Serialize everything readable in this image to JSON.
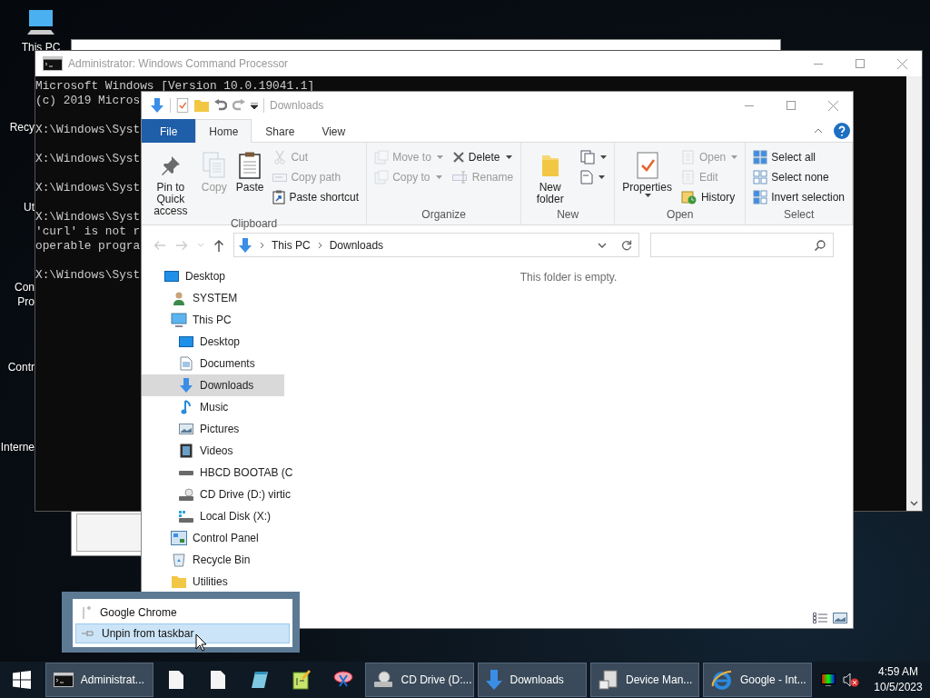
{
  "desktop_icons": [
    {
      "lines": [
        "This PC"
      ]
    },
    {
      "lines": [
        "Recy"
      ]
    },
    {
      "lines": [
        "Ut"
      ]
    },
    {
      "lines": [
        "Con",
        "Pro"
      ]
    },
    {
      "lines": [
        "Contr"
      ]
    },
    {
      "lines": [
        "Interne"
      ]
    }
  ],
  "cmd_window": {
    "title": "Administrator: Windows Command Processor",
    "blocks": [
      [
        "Microsoft Windows [Version 10.0.19041.1]",
        "(c) 2019 Micros"
      ],
      [
        "X:\\Windows\\Syst"
      ],
      [
        "X:\\Windows\\Syst"
      ],
      [
        "X:\\Windows\\Syst"
      ],
      [
        "X:\\Windows\\Syst",
        "'curl' is not r",
        "operable progra"
      ],
      [
        "X:\\Windows\\Syst"
      ]
    ]
  },
  "explorer": {
    "title": "Downloads",
    "tabs": [
      {
        "label": "File",
        "kind": "file",
        "selected": false
      },
      {
        "label": "Home",
        "kind": "tab",
        "selected": true
      },
      {
        "label": "Share",
        "kind": "tab",
        "selected": false
      },
      {
        "label": "View",
        "kind": "tab",
        "selected": false
      }
    ],
    "ribbon": {
      "groups": [
        {
          "label": "Clipboard",
          "columns": [
            {
              "kind": "large",
              "items": [
                {
                  "label": "Pin to Quick access",
                  "disabled": false,
                  "dropdown": false
                }
              ]
            },
            {
              "kind": "large",
              "items": [
                {
                  "label": "Copy",
                  "disabled": true,
                  "dropdown": false
                }
              ]
            },
            {
              "kind": "large",
              "items": [
                {
                  "label": "Paste",
                  "disabled": false,
                  "dropdown": false
                }
              ]
            },
            {
              "kind": "stack",
              "items": [
                {
                  "label": "Cut",
                  "disabled": true,
                  "dropdown": false
                },
                {
                  "label": "Copy path",
                  "disabled": true,
                  "dropdown": false
                },
                {
                  "label": "Paste shortcut",
                  "disabled": false,
                  "dropdown": false
                }
              ]
            }
          ]
        },
        {
          "label": "Organize",
          "columns": [
            {
              "kind": "stack",
              "items": [
                {
                  "label": "Move to",
                  "disabled": true,
                  "dropdown": true
                },
                {
                  "label": "Copy to",
                  "disabled": true,
                  "dropdown": true
                }
              ]
            },
            {
              "kind": "stack",
              "items": [
                {
                  "label": "Delete",
                  "disabled": false,
                  "dropdown": true
                },
                {
                  "label": "Rename",
                  "disabled": true,
                  "dropdown": false
                }
              ]
            }
          ]
        },
        {
          "label": "New",
          "columns": [
            {
              "kind": "large",
              "items": [
                {
                  "label": "New folder",
                  "disabled": false,
                  "dropdown": false
                }
              ]
            },
            {
              "kind": "stack",
              "items": [
                {
                  "disabled": false,
                  "dropdown": true
                },
                {
                  "disabled": false,
                  "dropdown": true
                }
              ]
            }
          ]
        },
        {
          "label": "Open",
          "columns": [
            {
              "kind": "large",
              "items": [
                {
                  "label": "Properties",
                  "disabled": false,
                  "dropdown": true
                }
              ]
            },
            {
              "kind": "stack",
              "items": [
                {
                  "label": "Open",
                  "disabled": true,
                  "dropdown": true
                },
                {
                  "label": "Edit",
                  "disabled": true,
                  "dropdown": false
                },
                {
                  "label": "History",
                  "disabled": false,
                  "dropdown": false
                }
              ]
            }
          ]
        },
        {
          "label": "Select",
          "columns": [
            {
              "kind": "stack",
              "items": [
                {
                  "label": "Select all",
                  "disabled": false,
                  "dropdown": false
                },
                {
                  "label": "Select none",
                  "disabled": false,
                  "dropdown": false
                },
                {
                  "label": "Invert selection",
                  "disabled": false,
                  "dropdown": false
                }
              ]
            }
          ]
        }
      ]
    },
    "breadcrumb": [
      "This PC",
      "Downloads"
    ],
    "nav_tree": [
      {
        "label": "Desktop",
        "kind": "desktop",
        "selected": false,
        "children": [
          {
            "label": "SYSTEM",
            "kind": "user",
            "selected": false
          },
          {
            "label": "This PC",
            "kind": "pc",
            "selected": false,
            "children": [
              {
                "label": "Desktop",
                "kind": "desktop",
                "selected": false
              },
              {
                "label": "Documents",
                "kind": "documents",
                "selected": false
              },
              {
                "label": "Downloads",
                "kind": "downloads",
                "selected": true
              },
              {
                "label": "Music",
                "kind": "music",
                "selected": false
              },
              {
                "label": "Pictures",
                "kind": "pictures",
                "selected": false
              },
              {
                "label": "Videos",
                "kind": "videos",
                "selected": false
              },
              {
                "label": "HBCD BOOTAB (C",
                "kind": "drive",
                "selected": false
              },
              {
                "label": "CD Drive (D:) virtic",
                "kind": "disc",
                "selected": false
              },
              {
                "label": "Local Disk (X:)",
                "kind": "disk",
                "selected": false
              }
            ]
          },
          {
            "label": "Control Panel",
            "kind": "panel",
            "selected": false
          },
          {
            "label": "Recycle Bin",
            "kind": "bin",
            "selected": false
          },
          {
            "label": "Utilities",
            "kind": "folder",
            "selected": false
          }
        ]
      }
    ],
    "empty_message": "This folder is empty."
  },
  "jump_list": [
    {
      "label": "Google Chrome",
      "selected": false
    },
    {
      "label": "Unpin from taskbar",
      "selected": true
    }
  ],
  "taskbar": {
    "items": [
      {
        "kind": "start"
      },
      {
        "kind": "window",
        "label": "Administrat..."
      },
      {
        "kind": "pinned"
      },
      {
        "kind": "pinned"
      },
      {
        "kind": "pinned"
      },
      {
        "kind": "pinned"
      },
      {
        "kind": "pinned"
      },
      {
        "kind": "window",
        "label": "CD Drive (D:..."
      },
      {
        "kind": "window",
        "label": "Downloads"
      },
      {
        "kind": "window",
        "label": "Device Man..."
      },
      {
        "kind": "window",
        "label": "Google - Int..."
      }
    ],
    "time": "4:59 AM",
    "date": "10/5/2023"
  }
}
